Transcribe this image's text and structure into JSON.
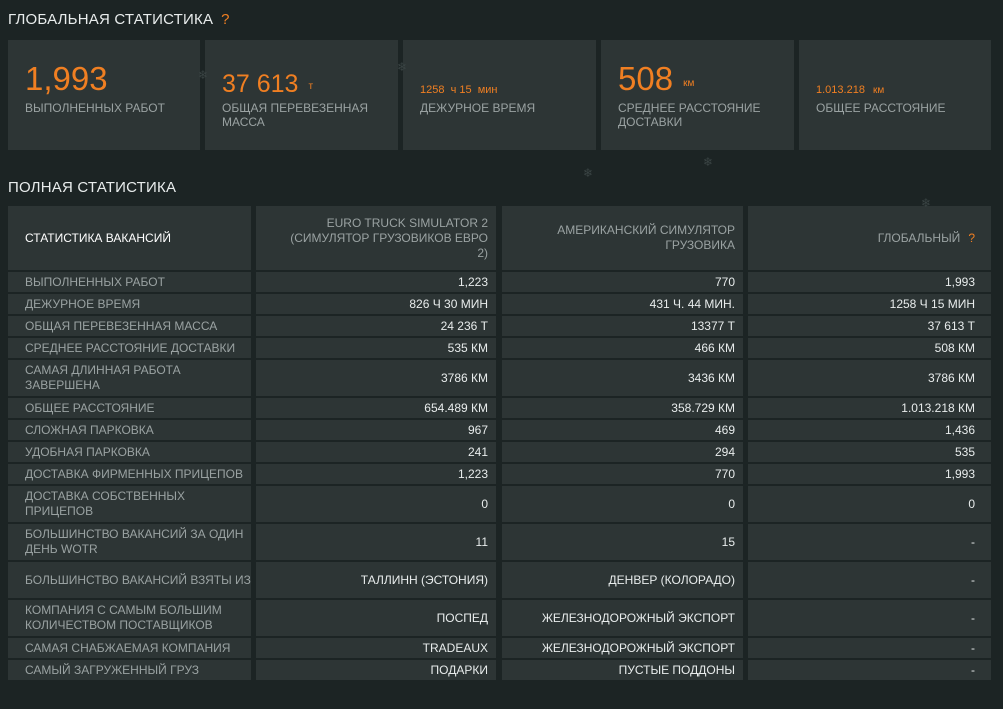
{
  "global": {
    "title": "ГЛОБАЛЬНАЯ СТАТИСТИКА",
    "help": "?",
    "cards": [
      {
        "value": "1,993",
        "unit": "",
        "label": "ВЫПОЛНЕННЫХ РАБОТ"
      },
      {
        "value": "37 613",
        "unit": "т",
        "label": "ОБЩАЯ ПЕРЕВЕЗЕННАЯ МАССА"
      },
      {
        "value": "1258  ч 15  мин",
        "unit": "",
        "label": "ДЕЖУРНОЕ ВРЕМЯ"
      },
      {
        "value": "508",
        "unit": "км",
        "label": "СРЕДНЕЕ РАССТОЯНИЕ ДОСТАВКИ"
      },
      {
        "value": "1.013.218",
        "unit": "км",
        "label": "ОБЩЕЕ РАССТОЯНИЕ"
      }
    ]
  },
  "full": {
    "title": "ПОЛНАЯ СТАТИСТИКА",
    "header": {
      "c0": "СТАТИСТИКА ВАКАНСИЙ",
      "c1": "EURO TRUCK SIMULATOR 2 (СИМУЛЯТОР ГРУЗОВИКОВ ЕВРО 2)",
      "c2": "АМЕРИКАНСКИЙ СИМУЛЯТОР ГРУЗОВИКА",
      "c3": "ГЛОБАЛЬНЫЙ",
      "c3_help": "?"
    },
    "rows": [
      {
        "label": "ВЫПОЛНЕННЫХ РАБОТ",
        "ets2": "1,223",
        "ats": "770",
        "global": "1,993"
      },
      {
        "label": "ДЕЖУРНОЕ ВРЕМЯ",
        "ets2": "826 Ч 30 МИН",
        "ats": "431 Ч. 44 МИН.",
        "global": "1258 Ч 15 МИН"
      },
      {
        "label": "ОБЩАЯ ПЕРЕВЕЗЕННАЯ МАССА",
        "ets2": "24 236 Т",
        "ats": "13377 Т",
        "global": "37 613 Т"
      },
      {
        "label": "СРЕДНЕЕ РАССТОЯНИЕ ДОСТАВКИ",
        "ets2": "535 КМ",
        "ats": "466 КМ",
        "global": "508 КМ"
      },
      {
        "label": "САМАЯ ДЛИННАЯ РАБОТА ЗАВЕРШЕНА",
        "ets2": "3786 КМ",
        "ats": "3436 КМ",
        "global": "3786 КМ"
      },
      {
        "label": "ОБЩЕЕ РАССТОЯНИЕ",
        "ets2": "654.489 КМ",
        "ats": "358.729 КМ",
        "global": "1.013.218 КМ"
      },
      {
        "label": "СЛОЖНАЯ ПАРКОВКА",
        "ets2": "967",
        "ats": "469",
        "global": "1,436"
      },
      {
        "label": "УДОБНАЯ ПАРКОВКА",
        "ets2": "241",
        "ats": "294",
        "global": "535"
      },
      {
        "label": "ДОСТАВКА ФИРМЕННЫХ ПРИЦЕПОВ",
        "ets2": "1,223",
        "ats": "770",
        "global": "1,993"
      },
      {
        "label": "ДОСТАВКА СОБСТВЕННЫХ ПРИЦЕПОВ",
        "ets2": "0",
        "ats": "0",
        "global": "0"
      },
      {
        "label": "БОЛЬШИНСТВО ВАКАНСИЙ ЗА ОДИН ДЕНЬ WOTR",
        "ets2": "11",
        "ats": "15",
        "global": "-"
      },
      {
        "label": "БОЛЬШИНСТВО ВАКАНСИЙ ВЗЯТЫ ИЗ",
        "ets2": "ТАЛЛИНН (ЭСТОНИЯ)",
        "ats": "ДЕНВЕР (КОЛОРАДО)",
        "global": "-"
      },
      {
        "label": "КОМПАНИЯ С САМЫМ БОЛЬШИМ КОЛИЧЕСТВОМ ПОСТАВЩИКОВ",
        "ets2": "ПОСПЕД",
        "ats": "ЖЕЛЕЗНОДОРОЖНЫЙ ЭКСПОРТ",
        "global": "-"
      },
      {
        "label": "САМАЯ СНАБЖАЕМАЯ КОМПАНИЯ",
        "ets2": "TRADEAUX",
        "ats": "ЖЕЛЕЗНОДОРОЖНЫЙ ЭКСПОРТ",
        "global": "-"
      },
      {
        "label": "САМЫЙ ЗАГРУЖЕННЫЙ ГРУЗ",
        "ets2": "ПОДАРКИ",
        "ats": "ПУСТЫЕ ПОДДОНЫ",
        "global": "-"
      }
    ]
  },
  "colors": {
    "background": "#1c2424",
    "panel": "#2d3535",
    "accent": "#f07f22",
    "text_muted": "#9aa2a2",
    "text_bright": "#e8ecec"
  },
  "icons": [
    "help-icon",
    "snowflake-icon"
  ]
}
